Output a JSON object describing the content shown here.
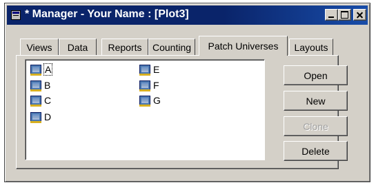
{
  "window": {
    "title": "* Manager - Your Name : [Plot3]"
  },
  "tabs": [
    {
      "label": "Views"
    },
    {
      "label": "Data"
    },
    {
      "label": "Reports"
    },
    {
      "label": "Counting"
    },
    {
      "label": "Patch Universes",
      "active": true
    },
    {
      "label": "Layouts"
    }
  ],
  "list": {
    "items": [
      {
        "label": "A",
        "selected": true
      },
      {
        "label": "B"
      },
      {
        "label": "C"
      },
      {
        "label": "D"
      },
      {
        "label": "E"
      },
      {
        "label": "F"
      },
      {
        "label": "G"
      }
    ]
  },
  "buttons": {
    "open": "Open",
    "new": "New",
    "clone": "Clone",
    "delete": "Delete"
  },
  "colors": {
    "titlebar": "#0a246a",
    "face": "#d4d0c8"
  },
  "icons": {
    "window": "manager-window-icon",
    "item": "patch-universe-grid-icon"
  }
}
